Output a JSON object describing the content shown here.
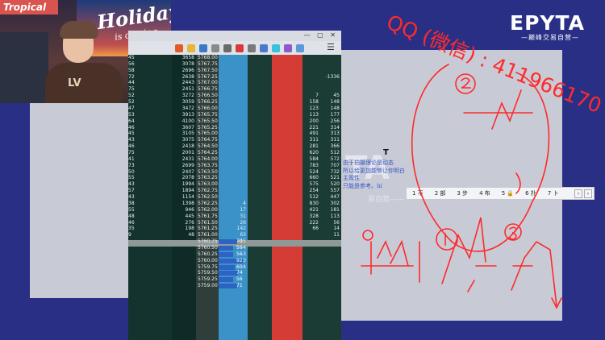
{
  "webcam": {
    "poster_text": "Holiday",
    "poster_sub": "is coming",
    "sign_text": "Tropical",
    "shirt_text": "LV"
  },
  "brand": {
    "logo": "EPYTA",
    "tagline": "—巅峰交易自营—"
  },
  "overlay": {
    "qq_text": "QQ (微信) : 411966170"
  },
  "watermark": {
    "big": "TA",
    "sub": "易自营——"
  },
  "note": {
    "lines": [
      "由于拍摄理论是动态",
      "所以给更加能够让你明白",
      "主观性",
      "只能是参考。hi"
    ]
  },
  "ime": {
    "candidates": [
      "1 不",
      "2 部",
      "3 步",
      "4 布",
      "5 🔒",
      "6 扑",
      "7 卜"
    ]
  },
  "colors": {
    "bid": "#3a92c9",
    "ask": "#d43c36",
    "sketch": "#ff2a2a"
  },
  "ladder": {
    "rows": [
      {
        "v": "3658",
        "p": "5768.00",
        "b": "",
        "a": "45",
        "r1": "",
        "r2": ""
      },
      {
        "v": "3078",
        "p": "5767.75",
        "b": "",
        "a": "56",
        "r1": "",
        "r2": ""
      },
      {
        "v": "2696",
        "p": "5767.50",
        "b": "",
        "a": "58",
        "r1": "",
        "r2": ""
      },
      {
        "v": "2638",
        "p": "5767.25",
        "b": "",
        "a": "72",
        "r1": "",
        "r2": "-1336"
      },
      {
        "v": "2443",
        "p": "5767.00",
        "b": "",
        "a": "44",
        "r1": "",
        "r2": ""
      },
      {
        "v": "2451",
        "p": "5766.75",
        "b": "",
        "a": "75",
        "r1": "",
        "r2": ""
      },
      {
        "v": "3272",
        "p": "5766.50",
        "b": "",
        "a": "52",
        "r1": "7",
        "r2": "45"
      },
      {
        "v": "3059",
        "p": "5766.25",
        "b": "",
        "a": "52",
        "r1": "158",
        "r2": "148"
      },
      {
        "v": "3472",
        "p": "5766.00",
        "b": "",
        "a": "47",
        "r1": "123",
        "r2": "148"
      },
      {
        "v": "3913",
        "p": "5765.75",
        "b": "",
        "a": "53",
        "r1": "113",
        "r2": "177"
      },
      {
        "v": "4100",
        "p": "5765.50",
        "b": "",
        "a": "64",
        "r1": "200",
        "r2": "256"
      },
      {
        "v": "3607",
        "p": "5765.25",
        "b": "",
        "a": "46",
        "r1": "221",
        "r2": "314"
      },
      {
        "v": "3105",
        "p": "5765.00",
        "b": "",
        "a": "45",
        "r1": "491",
        "r2": "313"
      },
      {
        "v": "3075",
        "p": "5764.75",
        "b": "",
        "a": "43",
        "r1": "311",
        "r2": "311"
      },
      {
        "v": "2418",
        "p": "5764.50",
        "b": "",
        "a": "46",
        "r1": "281",
        "r2": "366"
      },
      {
        "v": "2001",
        "p": "5764.25",
        "b": "",
        "a": "75",
        "r1": "620",
        "r2": "512"
      },
      {
        "v": "2431",
        "p": "5764.00",
        "b": "",
        "a": "41",
        "r1": "584",
        "r2": "572"
      },
      {
        "v": "2699",
        "p": "5763.75",
        "b": "",
        "a": "73",
        "r1": "783",
        "r2": "707"
      },
      {
        "v": "2407",
        "p": "5763.50",
        "b": "",
        "a": "50",
        "r1": "524",
        "r2": "732"
      },
      {
        "v": "2078",
        "p": "5763.25",
        "b": "",
        "a": "55",
        "r1": "660",
        "r2": "521"
      },
      {
        "v": "1994",
        "p": "5763.00",
        "b": "",
        "a": "43",
        "r1": "575",
        "r2": "520"
      },
      {
        "v": "1894",
        "p": "5762.75",
        "b": "",
        "a": "57",
        "r1": "254",
        "r2": "557"
      },
      {
        "v": "1154",
        "p": "5762.50",
        "b": "",
        "a": "43",
        "r1": "512",
        "r2": "447"
      },
      {
        "v": "1398",
        "p": "5762.25",
        "b": "4",
        "a": "38",
        "r1": "830",
        "r2": "302"
      },
      {
        "v": "946",
        "p": "5762.00",
        "b": "17",
        "a": "55",
        "r1": "421",
        "r2": "181"
      },
      {
        "v": "445",
        "p": "5761.75",
        "b": "31",
        "a": "48",
        "r1": "328",
        "r2": "113"
      },
      {
        "v": "276",
        "p": "5761.50",
        "b": "26",
        "a": "46",
        "r1": "222",
        "r2": "56"
      },
      {
        "v": "198",
        "p": "5761.25",
        "b": "142",
        "a": "35",
        "r1": "66",
        "r2": "14"
      },
      {
        "v": "48",
        "p": "5761.00",
        "b": "63",
        "a": "9",
        "r1": "",
        "r2": "11"
      },
      {
        "v": "",
        "p": "5760.75",
        "b": "-15",
        "a": "",
        "r1": "",
        "r2": ""
      },
      {
        "v": "",
        "p": "5760.50",
        "b": "-4",
        "a": "",
        "r1": "",
        "r2": ""
      },
      {
        "v": "",
        "p": "5760.25",
        "b": "-3",
        "a": "",
        "r1": "",
        "r2": ""
      },
      {
        "v": "",
        "p": "5760.00",
        "b": "-3",
        "a": "",
        "r1": "",
        "r2": ""
      },
      {
        "v": "",
        "p": "5759.75",
        "b": "-4",
        "a": "",
        "r1": "",
        "r2": ""
      },
      {
        "v": "",
        "p": "5759.50",
        "b": "",
        "a": "",
        "r1": "",
        "r2": ""
      },
      {
        "v": "",
        "p": "5759.25",
        "b": "",
        "a": "",
        "r1": "",
        "r2": ""
      },
      {
        "v": "",
        "p": "5759.00",
        "b": "",
        "a": "",
        "r1": "",
        "r2": ""
      }
    ],
    "bid_bars": [
      "70",
      "56",
      "56",
      "92",
      "60",
      "74",
      "56",
      "71"
    ]
  }
}
